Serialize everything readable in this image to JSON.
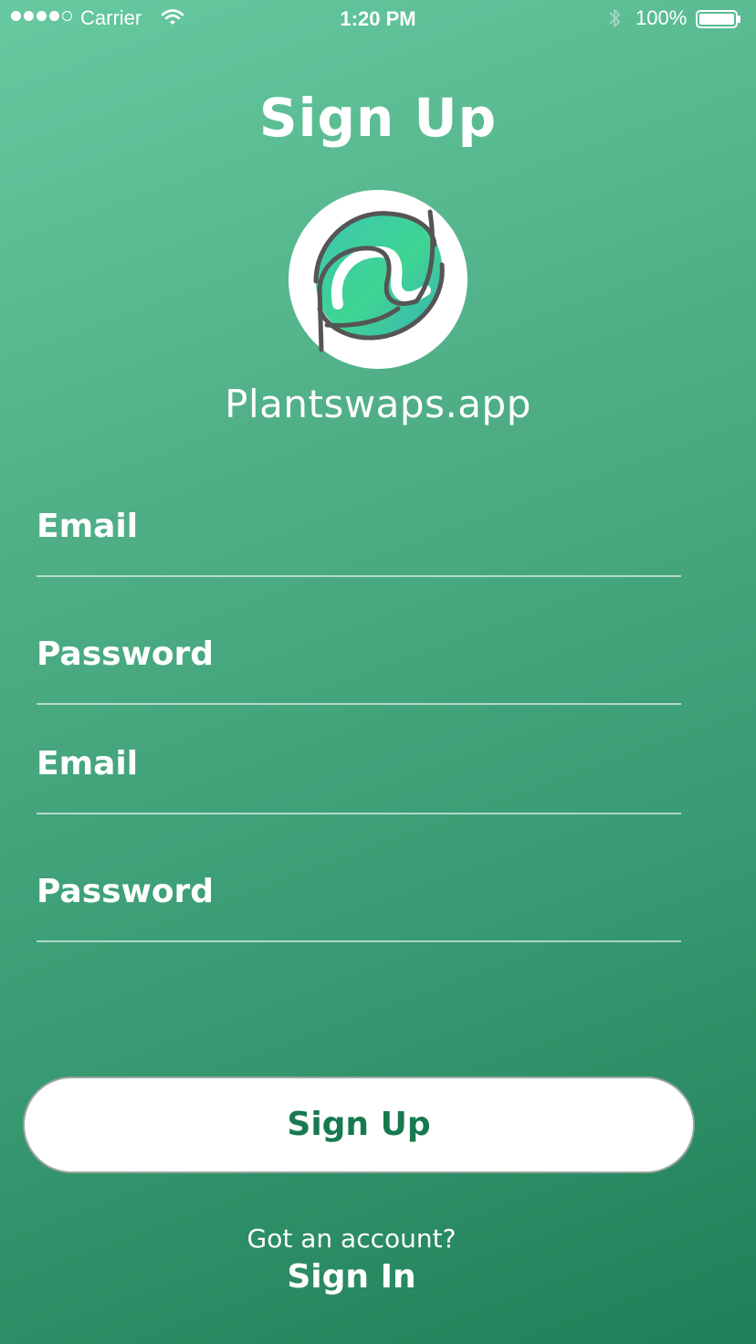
{
  "status_bar": {
    "carrier": "Carrier",
    "time": "1:20 PM",
    "battery": "100%",
    "signal_bars_filled": 4,
    "signal_bars_total": 5
  },
  "header": {
    "title": "Sign Up"
  },
  "brand": {
    "app_name": "Plantswaps.app",
    "logo_icon": "leaf-logo-icon"
  },
  "form": {
    "fields": [
      {
        "label": "Email"
      },
      {
        "label": "Password"
      },
      {
        "label": "Email"
      },
      {
        "label": "Password"
      }
    ],
    "submit_label": "Sign Up"
  },
  "footer": {
    "prompt": "Got an account?",
    "signin_label": "Sign In"
  },
  "colors": {
    "gradient_top": "#66c9a0",
    "gradient_bottom": "#1f7f58",
    "button_text": "#177a4e"
  }
}
